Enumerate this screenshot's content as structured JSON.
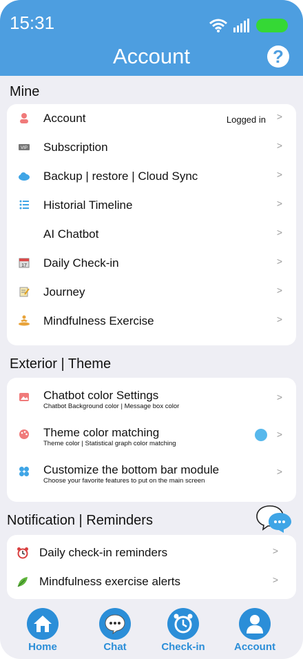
{
  "status": {
    "time": "15:31"
  },
  "header": {
    "title": "Account",
    "help_icon": "question-circle-icon"
  },
  "mine": {
    "title": "Mine",
    "items": [
      {
        "label": "Account",
        "extra": "Logged in",
        "icon": "user-icon",
        "chev": ">"
      },
      {
        "label": "Subscription",
        "icon": "vip-icon",
        "chev": ">"
      },
      {
        "label": "Backup | restore | Cloud Sync",
        "icon": "cloud-icon",
        "chev": ">"
      },
      {
        "label": "Historial Timeline",
        "icon": "timeline-icon",
        "chev": ">"
      },
      {
        "label": "AI Chatbot",
        "icon": "",
        "chev": ">"
      },
      {
        "label": "Daily Check-in",
        "icon": "calendar-icon",
        "chev": ">"
      },
      {
        "label": "Journey",
        "icon": "memo-icon",
        "chev": ">"
      },
      {
        "label": "Mindfulness Exercise",
        "icon": "meditation-icon",
        "chev": ">"
      }
    ]
  },
  "exterior": {
    "title": "Exterior | Theme",
    "items": [
      {
        "label": "Chatbot color Settings",
        "sub": "Chatbot Background color | Message box color",
        "icon": "image-icon",
        "chev": ">"
      },
      {
        "label": "Theme color matching",
        "sub": "Theme color | Statistical graph color matching",
        "icon": "palette-icon",
        "chev": ">",
        "swatch": "#57b8ec"
      },
      {
        "label": "Customize the bottom bar module",
        "sub": "Choose your favorite features to put on the main screen",
        "icon": "grid-icon",
        "chev": ">"
      }
    ]
  },
  "notifications": {
    "title": "Notification | Reminders",
    "items": [
      {
        "label": "Daily check-in reminders",
        "icon": "alarm-clock-icon",
        "chev": ">"
      },
      {
        "label": "Mindfulness exercise alerts",
        "icon": "leaf-icon",
        "chev": ">"
      }
    ]
  },
  "tabs": [
    {
      "label": "Home",
      "icon": "home-icon"
    },
    {
      "label": "Chat",
      "icon": "chat-icon"
    },
    {
      "label": "Check-in",
      "icon": "alarm-icon"
    },
    {
      "label": "Account",
      "icon": "user-icon"
    }
  ],
  "colors": {
    "header": "#4d9ee0",
    "tab": "#2b8ed8",
    "battery": "#35d835"
  }
}
